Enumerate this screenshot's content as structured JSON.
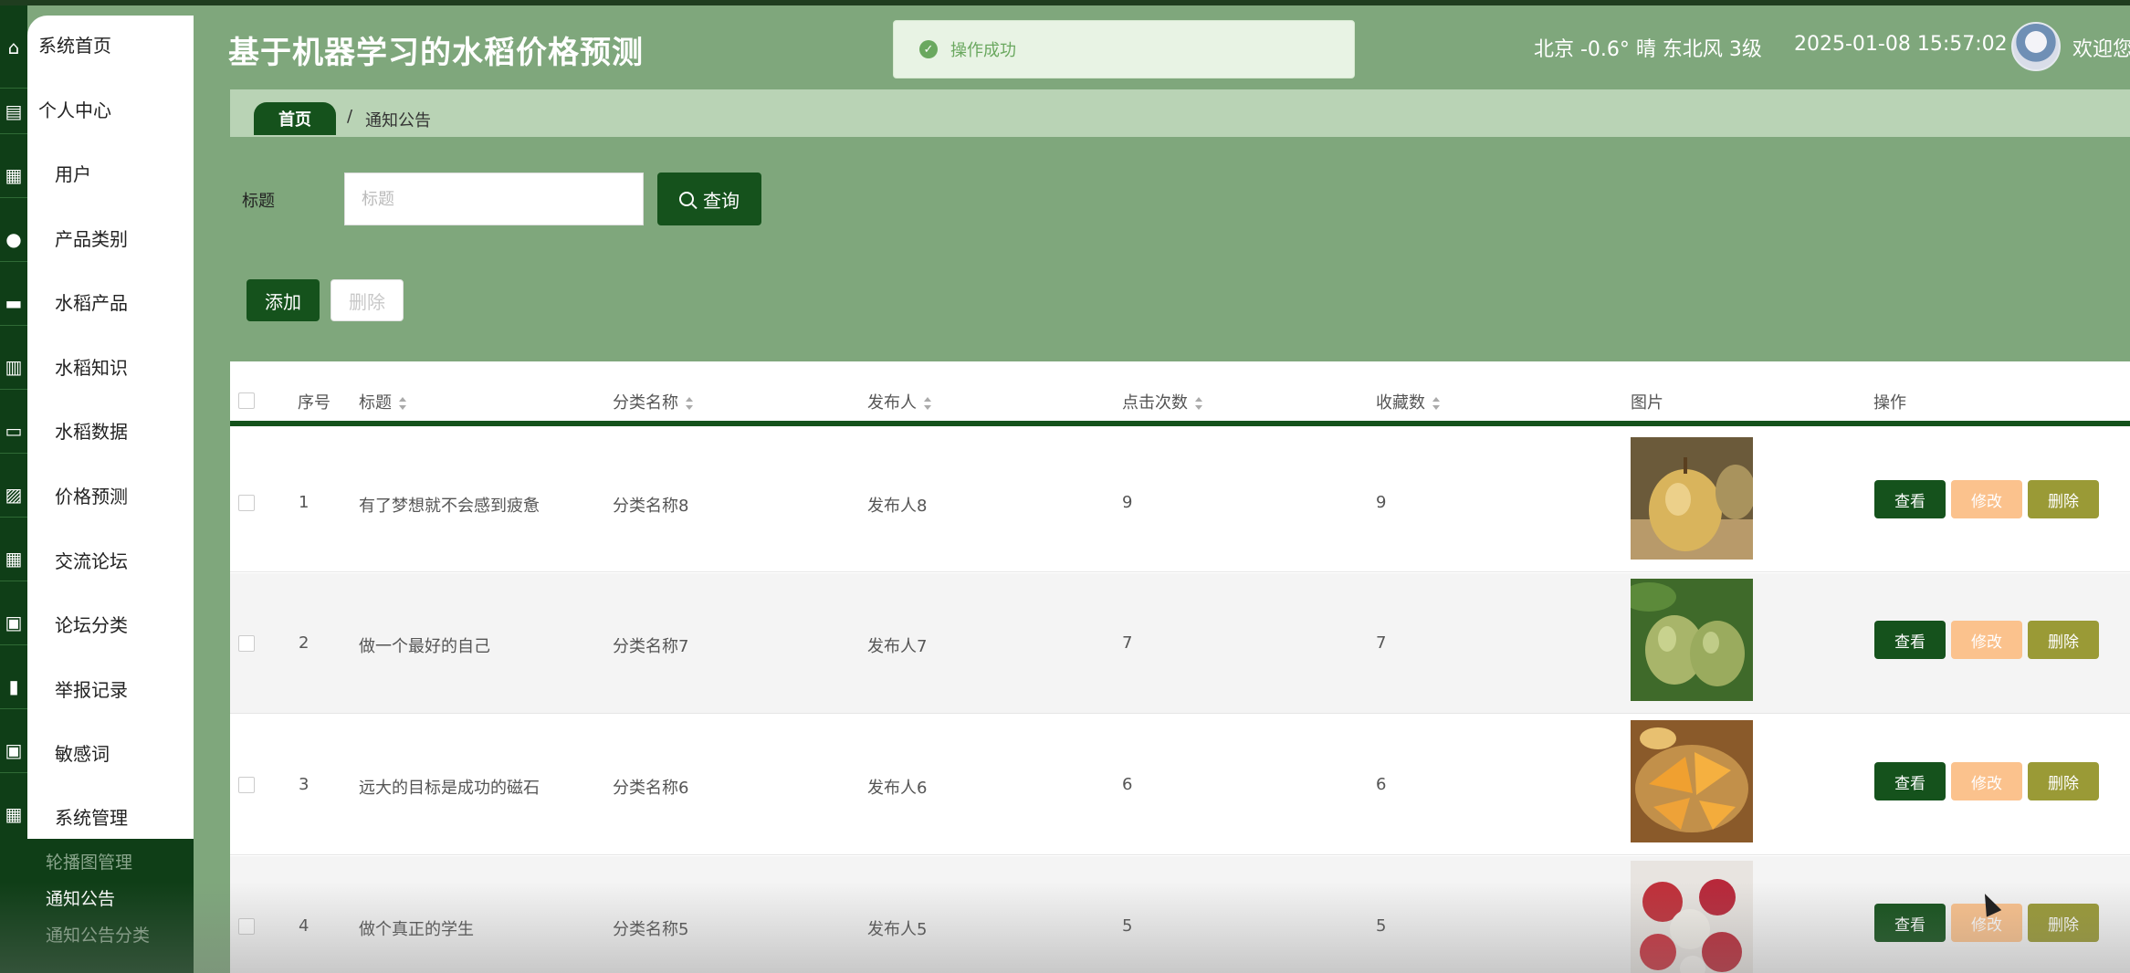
{
  "header": {
    "title": "基于机器学习的水稻价格预测",
    "weather": "北京 -0.6° 晴 东北风 3级",
    "datetime": "2025-01-08 15:57:02",
    "welcome": "欢迎您"
  },
  "toast": {
    "message": "操作成功"
  },
  "sidebar": {
    "items": [
      {
        "label": "系统首页"
      },
      {
        "label": "个人中心"
      },
      {
        "label": "用户"
      },
      {
        "label": "产品类别"
      },
      {
        "label": "水稻产品"
      },
      {
        "label": "水稻知识"
      },
      {
        "label": "水稻数据"
      },
      {
        "label": "价格预测"
      },
      {
        "label": "交流论坛"
      },
      {
        "label": "论坛分类"
      },
      {
        "label": "举报记录"
      },
      {
        "label": "敏感词"
      },
      {
        "label": "系统管理"
      }
    ],
    "subitems": [
      {
        "label": "轮播图管理"
      },
      {
        "label": "通知公告"
      },
      {
        "label": "通知公告分类"
      }
    ]
  },
  "breadcrumb": {
    "home": "首页",
    "separator": "/",
    "current": "通知公告"
  },
  "search": {
    "label": "标题",
    "placeholder": "标题",
    "button": "查询"
  },
  "actions": {
    "add": "添加",
    "delete": "删除"
  },
  "table": {
    "headers": [
      "序号",
      "标题",
      "分类名称",
      "发布人",
      "点击次数",
      "收藏数",
      "图片",
      "操作"
    ],
    "rows": [
      {
        "index": "1",
        "title": "有了梦想就不会感到疲惫",
        "category": "分类名称8",
        "publisher": "发布人8",
        "clicks": "9",
        "favorites": "9",
        "image": "pear-photo"
      },
      {
        "index": "2",
        "title": "做一个最好的自己",
        "category": "分类名称7",
        "publisher": "发布人7",
        "clicks": "7",
        "favorites": "7",
        "image": "green-pears-photo"
      },
      {
        "index": "3",
        "title": "远大的目标是成功的磁石",
        "category": "分类名称6",
        "publisher": "发布人6",
        "clicks": "6",
        "favorites": "6",
        "image": "melon-photo"
      },
      {
        "index": "4",
        "title": "做个真正的学生",
        "category": "分类名称5",
        "publisher": "发布人5",
        "clicks": "5",
        "favorites": "5",
        "image": "lychee-photo"
      }
    ],
    "ops": {
      "view": "查看",
      "edit": "修改",
      "delete": "删除"
    }
  },
  "colors": {
    "primary": "#15521c",
    "background": "#7fa77c",
    "edit": "#fbc28d",
    "delete": "#9a9a36"
  }
}
